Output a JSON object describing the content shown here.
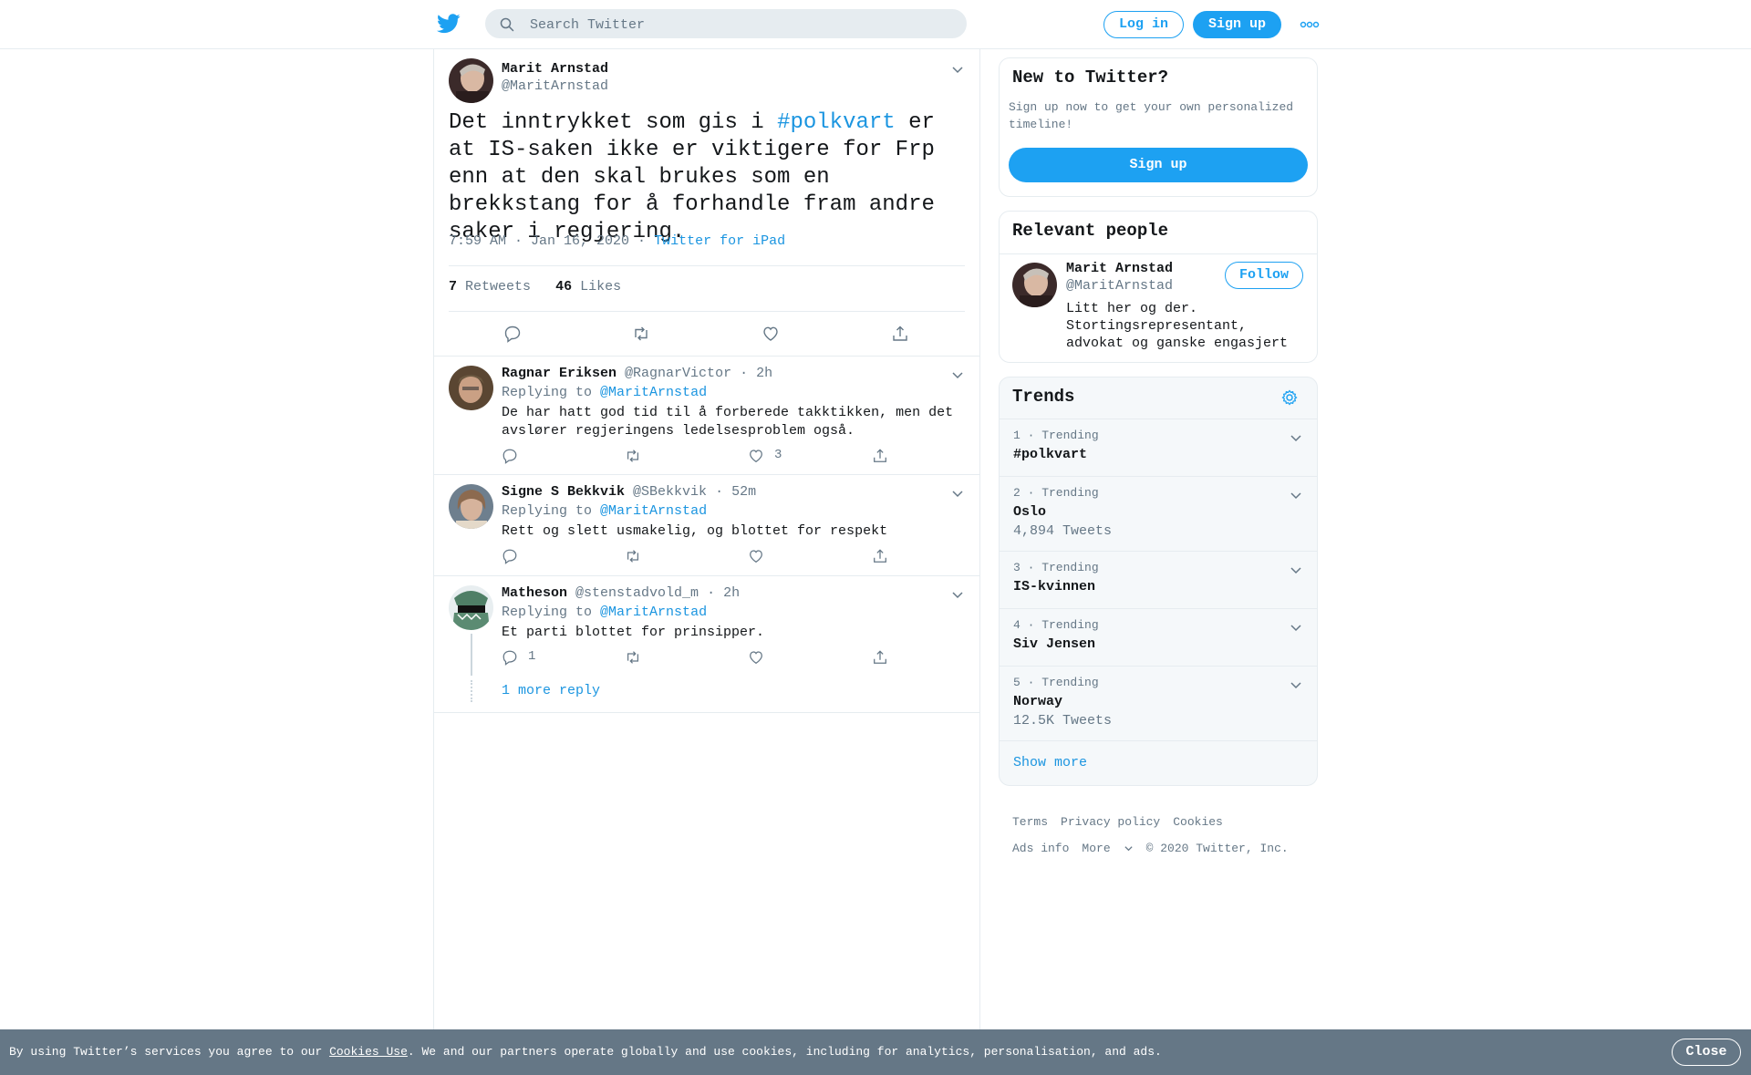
{
  "header": {
    "search_placeholder": "Search Twitter",
    "login_label": "Log in",
    "signup_label": "Sign up"
  },
  "main_tweet": {
    "name": "Marit Arnstad",
    "handle": "@MaritArnstad",
    "text_before": "Det inntrykket som gis i ",
    "hashtag": "#polkvart",
    "text_after": " er at IS-saken ikke er viktigere for Frp enn at den skal brukes som en brekkstang for å forhandle fram andre saker i regjering.",
    "timestamp": "7:59 AM · Jan 16, 2020",
    "source": "Twitter for iPad",
    "retweets_count": "7",
    "retweets_label": "Retweets",
    "likes_count": "46",
    "likes_label": "Likes"
  },
  "replies": [
    {
      "name": "Ragnar Eriksen",
      "handle": "@RagnarVictor",
      "time": "2h",
      "replying_label": "Replying to",
      "replying_to": "@MaritArnstad",
      "text": "De har hatt god tid til å forberede takktikken, men det avslører regjeringens ledelsesproblem også.",
      "reply_count": "",
      "like_count": "3"
    },
    {
      "name": "Signe S Bekkvik",
      "handle": "@SBekkvik",
      "time": "52m",
      "replying_label": "Replying to",
      "replying_to": "@MaritArnstad",
      "text": "Rett og slett usmakelig, og blottet for respekt",
      "reply_count": "",
      "like_count": ""
    },
    {
      "name": "Matheson",
      "handle": "@stenstadvold_m",
      "time": "2h",
      "replying_label": "Replying to",
      "replying_to": "@MaritArnstad",
      "text": "Et parti blottet for prinsipper.",
      "reply_count": "1",
      "like_count": ""
    }
  ],
  "more_replies_label": "1 more reply",
  "sidebar": {
    "new_title": "New to Twitter?",
    "new_desc": "Sign up now to get your own personalized timeline!",
    "new_signup_label": "Sign up",
    "relevant_title": "Relevant people",
    "person": {
      "name": "Marit Arnstad",
      "handle": "@MaritArnstad",
      "bio": "Litt her og der. Stortingsrepresentant, advokat og ganske engasjert",
      "follow_label": "Follow"
    },
    "trends_title": "Trends",
    "trends": [
      {
        "label": "1 · Trending",
        "name": "#polkvart",
        "count": ""
      },
      {
        "label": "2 · Trending",
        "name": "Oslo",
        "count": "4,894 Tweets"
      },
      {
        "label": "3 · Trending",
        "name": "IS-kvinnen",
        "count": ""
      },
      {
        "label": "4 · Trending",
        "name": "Siv Jensen",
        "count": ""
      },
      {
        "label": "5 · Trending",
        "name": "Norway",
        "count": "12.5K Tweets"
      }
    ],
    "show_more_label": "Show more"
  },
  "footer": {
    "terms": "Terms",
    "privacy": "Privacy policy",
    "cookies": "Cookies",
    "ads_info": "Ads info",
    "more": "More",
    "copyright": "© 2020 Twitter, Inc."
  },
  "cookie_bar": {
    "text_before": "By using Twitter’s services you agree to our ",
    "link": "Cookies Use",
    "text_after": ". We and our partners operate globally and use cookies, including for analytics, personalisation, and ads.",
    "close_label": "Close"
  },
  "colors": {
    "accent": "#1da1f2",
    "link": "#1b95e0",
    "muted": "#657786",
    "border": "#e6ecf0",
    "cookie_bg": "#657786"
  }
}
